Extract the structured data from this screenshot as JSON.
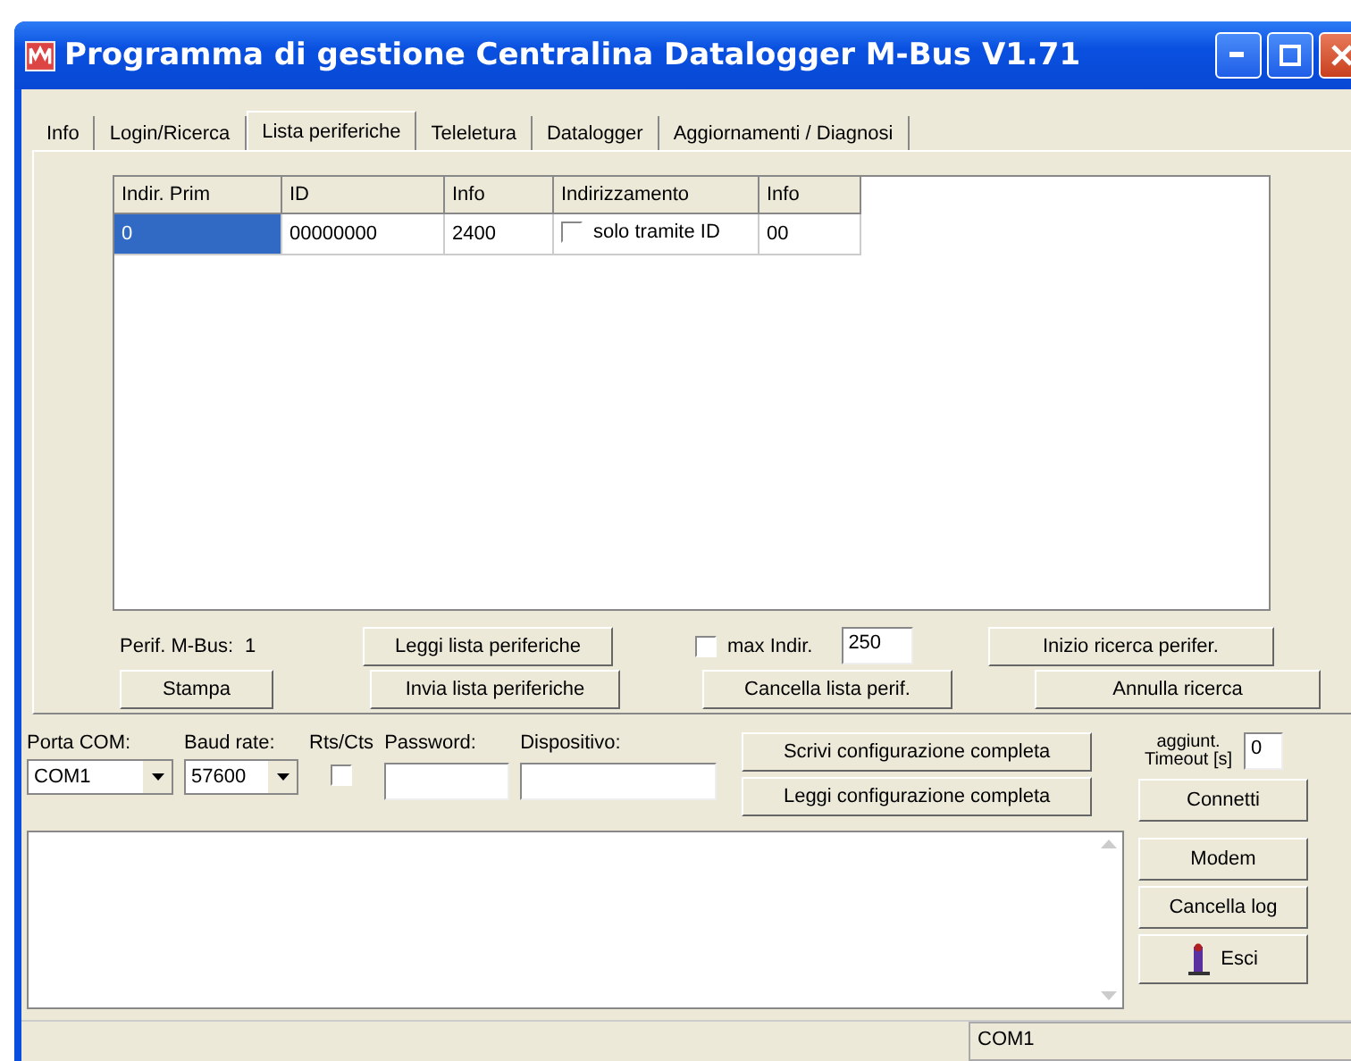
{
  "window": {
    "title": "Programma di gestione Centralina Datalogger M-Bus V1.71"
  },
  "tabs": [
    {
      "label": "Info",
      "selected": false
    },
    {
      "label": "Login/Ricerca",
      "selected": false
    },
    {
      "label": "Lista periferiche",
      "selected": true
    },
    {
      "label": "Teleletura",
      "selected": false
    },
    {
      "label": "Datalogger",
      "selected": false
    },
    {
      "label": "Aggiornamenti / Diagnosi",
      "selected": false
    }
  ],
  "table": {
    "columns": [
      "Indir. Prim",
      "ID",
      "Info",
      "Indirizzamento",
      "Info"
    ],
    "rows": [
      {
        "selected": true,
        "indir_prim": "0",
        "id": "00000000",
        "info": "2400",
        "addressing": {
          "label": "solo tramite ID",
          "checked": false
        },
        "info_2": "00"
      }
    ]
  },
  "device_count": {
    "label": "Perif. M-Bus:",
    "value": "1"
  },
  "max_indir": {
    "label": "max Indir.",
    "checked": false,
    "value": "250"
  },
  "panel_buttons": [
    [
      "Leggi lista periferiche",
      "Inizio ricerca perifer."
    ],
    [
      "Stampa",
      "Invia lista periferiche",
      "Cancella lista perif.",
      "Annulla ricerca"
    ]
  ],
  "connection": {
    "port": {
      "label": "Porta COM:",
      "value": "COM1"
    },
    "baud": {
      "label": "Baud rate:",
      "value": "57600"
    },
    "rts_cts": {
      "label": "Rts/Cts",
      "checked": false
    },
    "password": {
      "label": "Password:"
    },
    "device": {
      "label": "Dispositivo:"
    },
    "config_buttons": [
      "Scrivi configurazione completa",
      "Leggi configurazione completa"
    ],
    "timeout": {
      "label": "aggiunt. Timeout [s]",
      "value": "0"
    }
  },
  "side_buttons": [
    {
      "label": "Connetti",
      "kind": "plain"
    },
    {
      "label": "Modem",
      "kind": "plain"
    },
    {
      "label": "Cancella log",
      "kind": "plain"
    },
    {
      "label": "Esci",
      "kind": "exit"
    }
  ],
  "status_bar": {
    "port": "COM1"
  }
}
